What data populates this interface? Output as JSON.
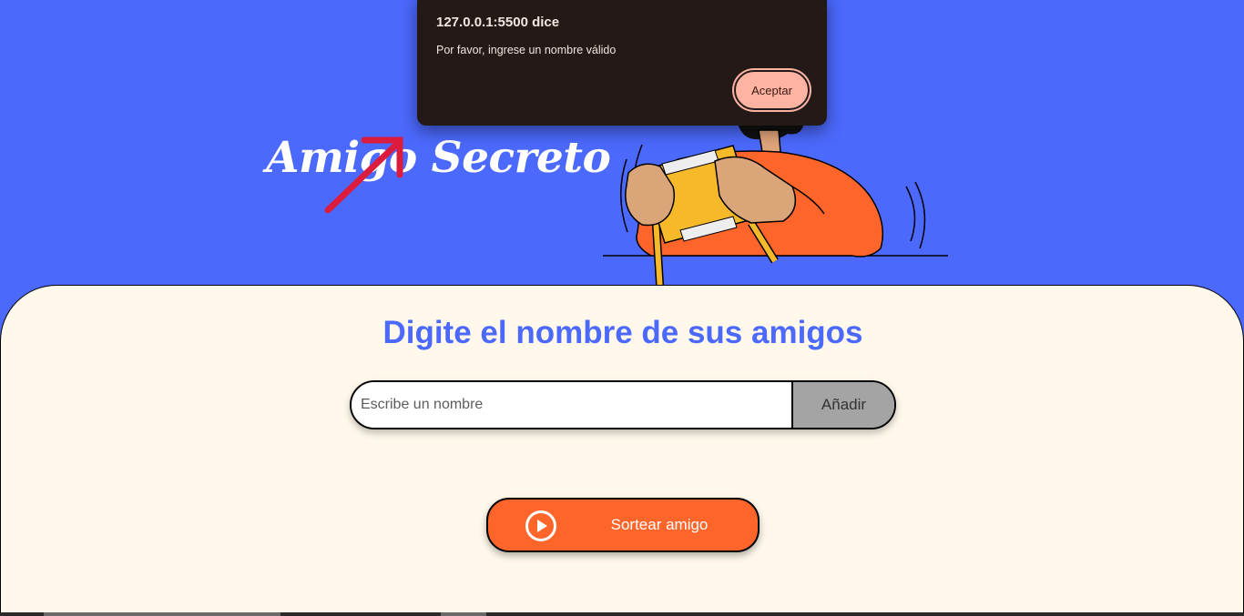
{
  "header": {
    "title": "Amigo Secreto"
  },
  "main": {
    "title": "Digite el nombre de sus amigos",
    "input_placeholder": "Escribe un nombre",
    "input_value": "",
    "add_label": "Añadir",
    "draw_label": "Sortear amigo",
    "draw_icon": "play-circle-icon"
  },
  "dialog": {
    "title": "127.0.0.1:5500 dice",
    "message": "Por favor, ingrese un nombre válido",
    "ok_label": "Aceptar"
  },
  "colors": {
    "background_blue": "#4b69fd",
    "card_cream": "#fff8eb",
    "accent_orange": "#fe652b",
    "add_button_gray": "#a4a4a4",
    "dialog_bg": "#231a18",
    "dialog_button": "#ffb3a3"
  }
}
